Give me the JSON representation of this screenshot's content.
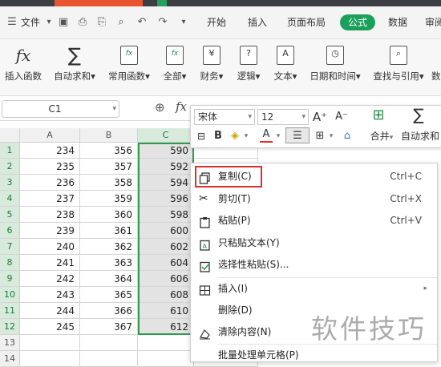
{
  "menubar": {
    "file": "文件",
    "tabs": [
      "开始",
      "插入",
      "页面布局",
      "公式",
      "数据",
      "审阅"
    ],
    "active_tab": "公式",
    "accent": "#1aa05a"
  },
  "ribbon": {
    "buttons": [
      {
        "label": "插入函数",
        "icon": "function-icon"
      },
      {
        "label": "自动求和▾",
        "icon": "sigma-icon"
      },
      {
        "label": "常用函数▾",
        "icon": "star-function-icon"
      },
      {
        "label": "全部▾",
        "icon": "function-box-icon"
      },
      {
        "label": "财务▾",
        "icon": "finance-icon"
      },
      {
        "label": "逻辑▾",
        "icon": "logic-icon"
      },
      {
        "label": "文本▾",
        "icon": "text-icon"
      },
      {
        "label": "日期和时间▾",
        "icon": "clock-icon"
      },
      {
        "label": "查找与引用▾",
        "icon": "lookup-icon"
      },
      {
        "label": "数",
        "icon": "math-icon"
      }
    ]
  },
  "formula_bar": {
    "name_box": "C1",
    "fx": "fx"
  },
  "mini_toolbar": {
    "font": "宋体",
    "size": "12",
    "merge": "合并",
    "autosum": "自动求和"
  },
  "sheet": {
    "columns": [
      "A",
      "B",
      "C"
    ],
    "row_numbers": [
      "1",
      "2",
      "3",
      "4",
      "5",
      "6",
      "7",
      "8",
      "9",
      "10",
      "11",
      "12",
      "13",
      "14"
    ],
    "rows": [
      [
        "234",
        "356",
        "590"
      ],
      [
        "235",
        "357",
        "592"
      ],
      [
        "236",
        "358",
        "594"
      ],
      [
        "237",
        "359",
        "596"
      ],
      [
        "238",
        "360",
        "598"
      ],
      [
        "239",
        "361",
        "600"
      ],
      [
        "240",
        "362",
        "602"
      ],
      [
        "241",
        "363",
        "604"
      ],
      [
        "242",
        "364",
        "606"
      ],
      [
        "243",
        "365",
        "608"
      ],
      [
        "244",
        "366",
        "610"
      ],
      [
        "245",
        "367",
        "612"
      ]
    ]
  },
  "context_menu": {
    "items": [
      {
        "label": "复制(C)",
        "shortcut": "Ctrl+C",
        "icon": "copy-icon"
      },
      {
        "label": "剪切(T)",
        "shortcut": "Ctrl+X",
        "icon": "cut-icon"
      },
      {
        "label": "粘贴(P)",
        "shortcut": "Ctrl+V",
        "icon": "paste-icon"
      },
      {
        "label": "只粘贴文本(Y)",
        "shortcut": "",
        "icon": "paste-text-icon"
      },
      {
        "label": "选择性粘贴(S)...",
        "shortcut": "",
        "icon": "paste-special-icon"
      },
      {
        "label": "插入(I)",
        "shortcut": "",
        "icon": "insert-icon"
      },
      {
        "label": "删除(D)",
        "shortcut": "",
        "icon": ""
      },
      {
        "label": "清除内容(N)",
        "shortcut": "",
        "icon": "eraser-icon"
      },
      {
        "label": "批量处理单元格(P)",
        "shortcut": "",
        "icon": ""
      }
    ],
    "highlight_color": "#d93030"
  },
  "watermark": "软件技巧"
}
